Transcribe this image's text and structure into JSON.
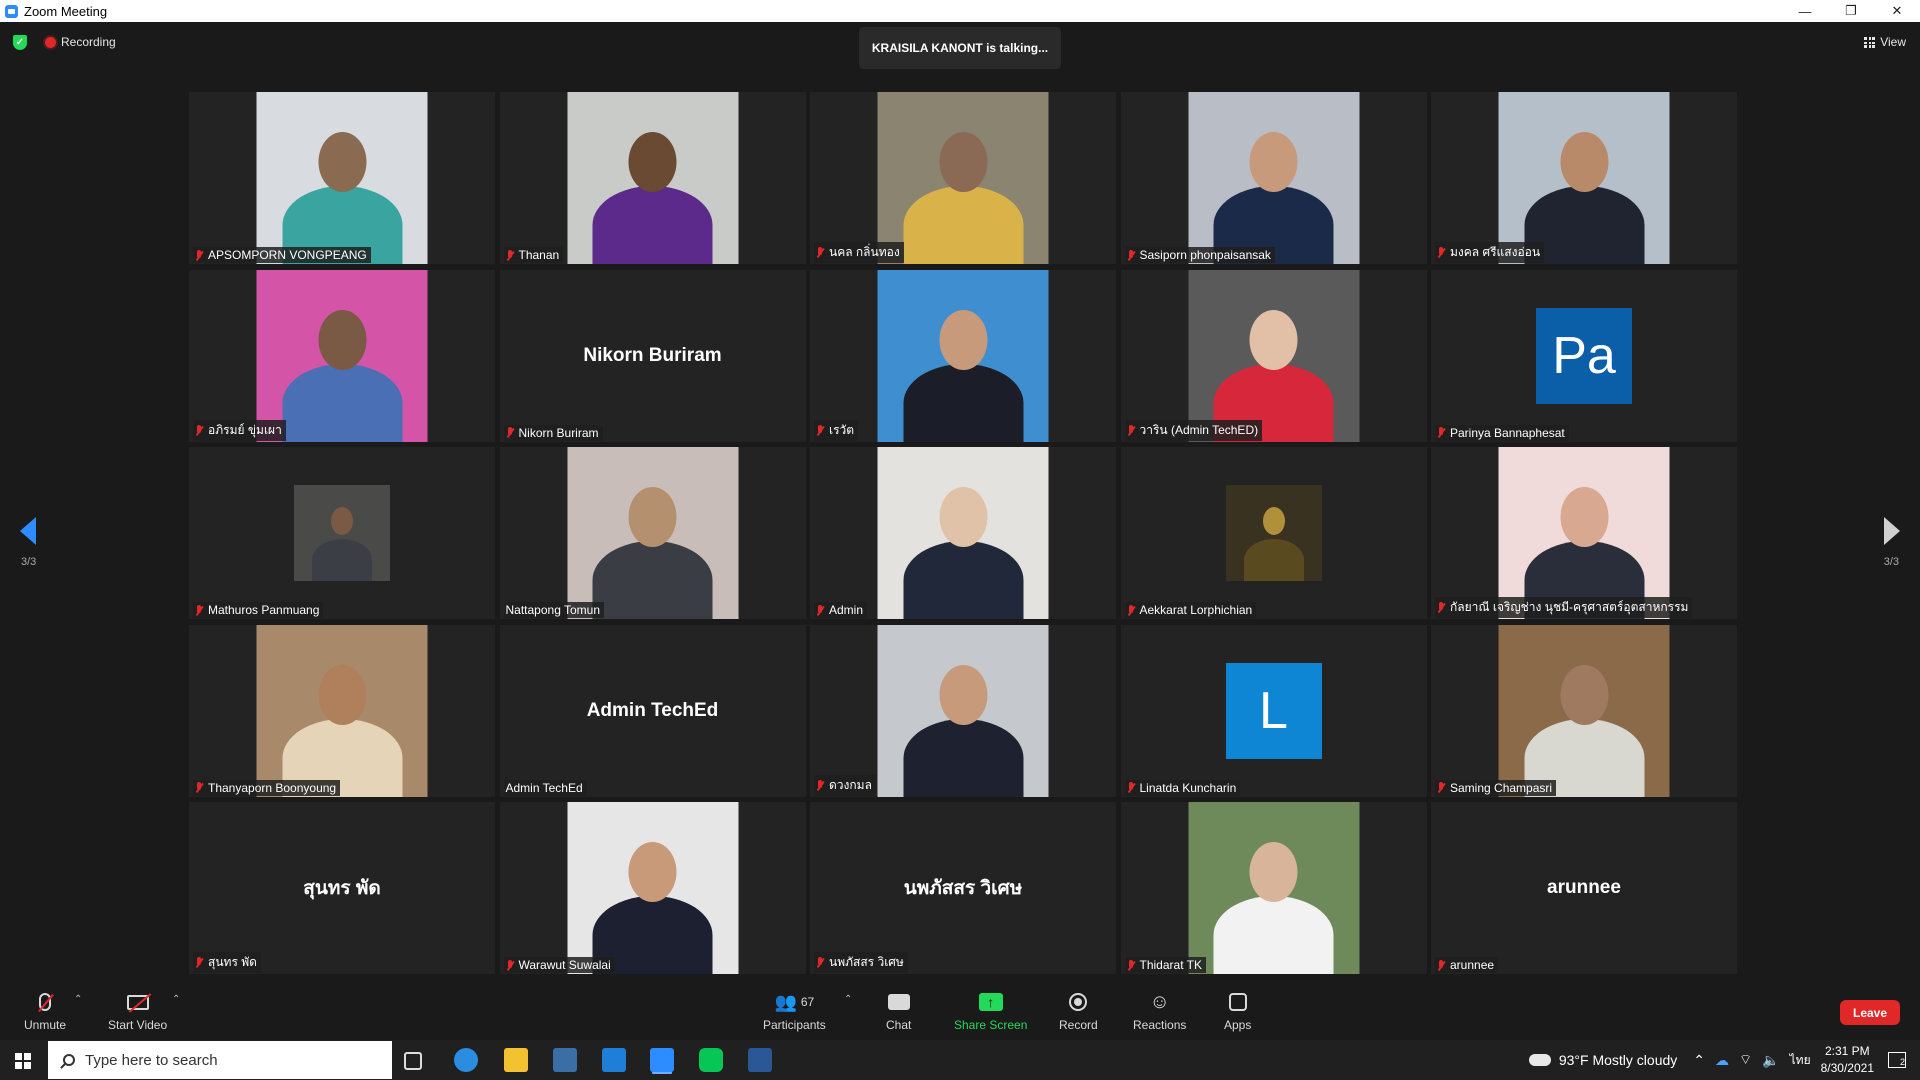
{
  "window": {
    "title": "Zoom Meeting",
    "controls": [
      "—",
      "❐",
      "✕"
    ]
  },
  "topbar": {
    "recording_label": "Recording",
    "talking": "KRAISILA KANONT is talking...",
    "view_label": "View"
  },
  "pagination": {
    "left": "3/3",
    "right": "3/3"
  },
  "participants": [
    {
      "name": "APSOMPORN VONGPEANG",
      "kind": "video",
      "bg": "#d8dbe0",
      "skin": "#8a6a50",
      "shirt": "#3aa5a0",
      "muted": true
    },
    {
      "name": "Thanan",
      "kind": "video",
      "bg": "#c9cbc8",
      "skin": "#6b4a34",
      "shirt": "#5b2a8a",
      "muted": true
    },
    {
      "name": "นคล กลิ่นทอง",
      "kind": "video",
      "bg": "#8a8470",
      "skin": "#8a6a55",
      "shirt": "#d9b24a",
      "muted": true
    },
    {
      "name": "Sasiporn phonpaisansak",
      "kind": "video",
      "bg": "#b9bdc6",
      "skin": "#c89a7c",
      "shirt": "#1c2a4a",
      "muted": true
    },
    {
      "name": "มงคล ศรีแสงอ่อน",
      "kind": "video",
      "bg": "#b5bfc9",
      "skin": "#b98a6a",
      "shirt": "#1f2430",
      "muted": true
    },
    {
      "name": "อภิรมย์ ขุ่มเผา",
      "kind": "video",
      "bg": "#d454a8",
      "skin": "#7a5a45",
      "shirt": "#4a6fb5",
      "muted": true
    },
    {
      "name": "Nikorn Buriram",
      "kind": "text",
      "display": "Nikorn Buriram",
      "muted": true
    },
    {
      "name": "เรวัต",
      "kind": "video",
      "bg": "#3f8fd0",
      "skin": "#c79a7c",
      "shirt": "#1b1e28",
      "muted": true
    },
    {
      "name": "วาริน  (Admin TechED)",
      "kind": "video",
      "bg": "#5a5a5a",
      "skin": "#e2c0a8",
      "shirt": "#d6283a",
      "muted": true
    },
    {
      "name": "Parinya Bannaphesat",
      "kind": "letter",
      "letter": "Pa",
      "color": "#0b5ea8",
      "muted": true
    },
    {
      "name": "Mathuros Panmuang",
      "kind": "small",
      "bg": "#4a4a48",
      "skin": "#7a5a45",
      "shirt": "#3b3f45",
      "muted": true
    },
    {
      "name": "Nattapong Tomun",
      "kind": "video",
      "bg": "#c8bdb8",
      "skin": "#b5906e",
      "shirt": "#3a3d44",
      "muted": false
    },
    {
      "name": "Admin",
      "kind": "video",
      "bg": "#e4e2de",
      "skin": "#e0c2a8",
      "shirt": "#20283a",
      "muted": true
    },
    {
      "name": "Aekkarat Lorphichian",
      "kind": "small",
      "bg": "#3a3220",
      "skin": "#b0903a",
      "shirt": "#5a4a20",
      "muted": true
    },
    {
      "name": "กัลยาณี เจริญช่าง นุชมี-ครุศาสตร์อุตสาหกรรม",
      "kind": "video",
      "bg": "#f0dada",
      "skin": "#d8a890",
      "shirt": "#2a2d3a",
      "muted": true
    },
    {
      "name": "Thanyaporn Boonyoung",
      "kind": "video",
      "bg": "#a88a6a",
      "skin": "#b07f5c",
      "shirt": "#e6d4b8",
      "muted": true
    },
    {
      "name": "Admin TechEd",
      "kind": "text",
      "display": "Admin TechEd",
      "muted": false
    },
    {
      "name": "ดวงกมล",
      "kind": "video",
      "bg": "#c5c8cc",
      "skin": "#c89a7c",
      "shirt": "#1e2230",
      "muted": true
    },
    {
      "name": "Linatda Kuncharin",
      "kind": "letter",
      "letter": "L",
      "color": "#0e86d4",
      "muted": true
    },
    {
      "name": "Saming Champasri",
      "kind": "video",
      "bg": "#8a6a48",
      "skin": "#a07a60",
      "shirt": "#d8d8d0",
      "muted": true
    },
    {
      "name": "สุนทร พัด",
      "kind": "text",
      "display": "สุนทร พัด",
      "muted": true
    },
    {
      "name": "Warawut Suwalai",
      "kind": "video",
      "bg": "#e6e6e6",
      "skin": "#c99a7a",
      "shirt": "#1c2030",
      "muted": true
    },
    {
      "name": "นพภัสสร วิเศษ",
      "kind": "text",
      "display": "นพภัสสร วิเศษ",
      "muted": true
    },
    {
      "name": "Thidarat TK",
      "kind": "video",
      "bg": "#6f8a5a",
      "skin": "#d8b49a",
      "shirt": "#f2f2f2",
      "muted": true
    },
    {
      "name": "arunnee",
      "kind": "text",
      "display": "arunnee",
      "muted": true
    }
  ],
  "toolbar": {
    "unmute": "Unmute",
    "start_video": "Start Video",
    "participants": "Participants",
    "participants_count": "67",
    "chat": "Chat",
    "share_screen": "Share Screen",
    "record": "Record",
    "reactions": "Reactions",
    "apps": "Apps",
    "leave": "Leave"
  },
  "taskbar": {
    "search_placeholder": "Type here to search",
    "weather": "93°F  Mostly cloudy",
    "language": "ไทย",
    "time": "2:31 PM",
    "date": "8/30/2021",
    "notifications": "2"
  },
  "colors": {
    "accent": "#2d8cff",
    "leave": "#e02828",
    "share": "#23d959"
  }
}
